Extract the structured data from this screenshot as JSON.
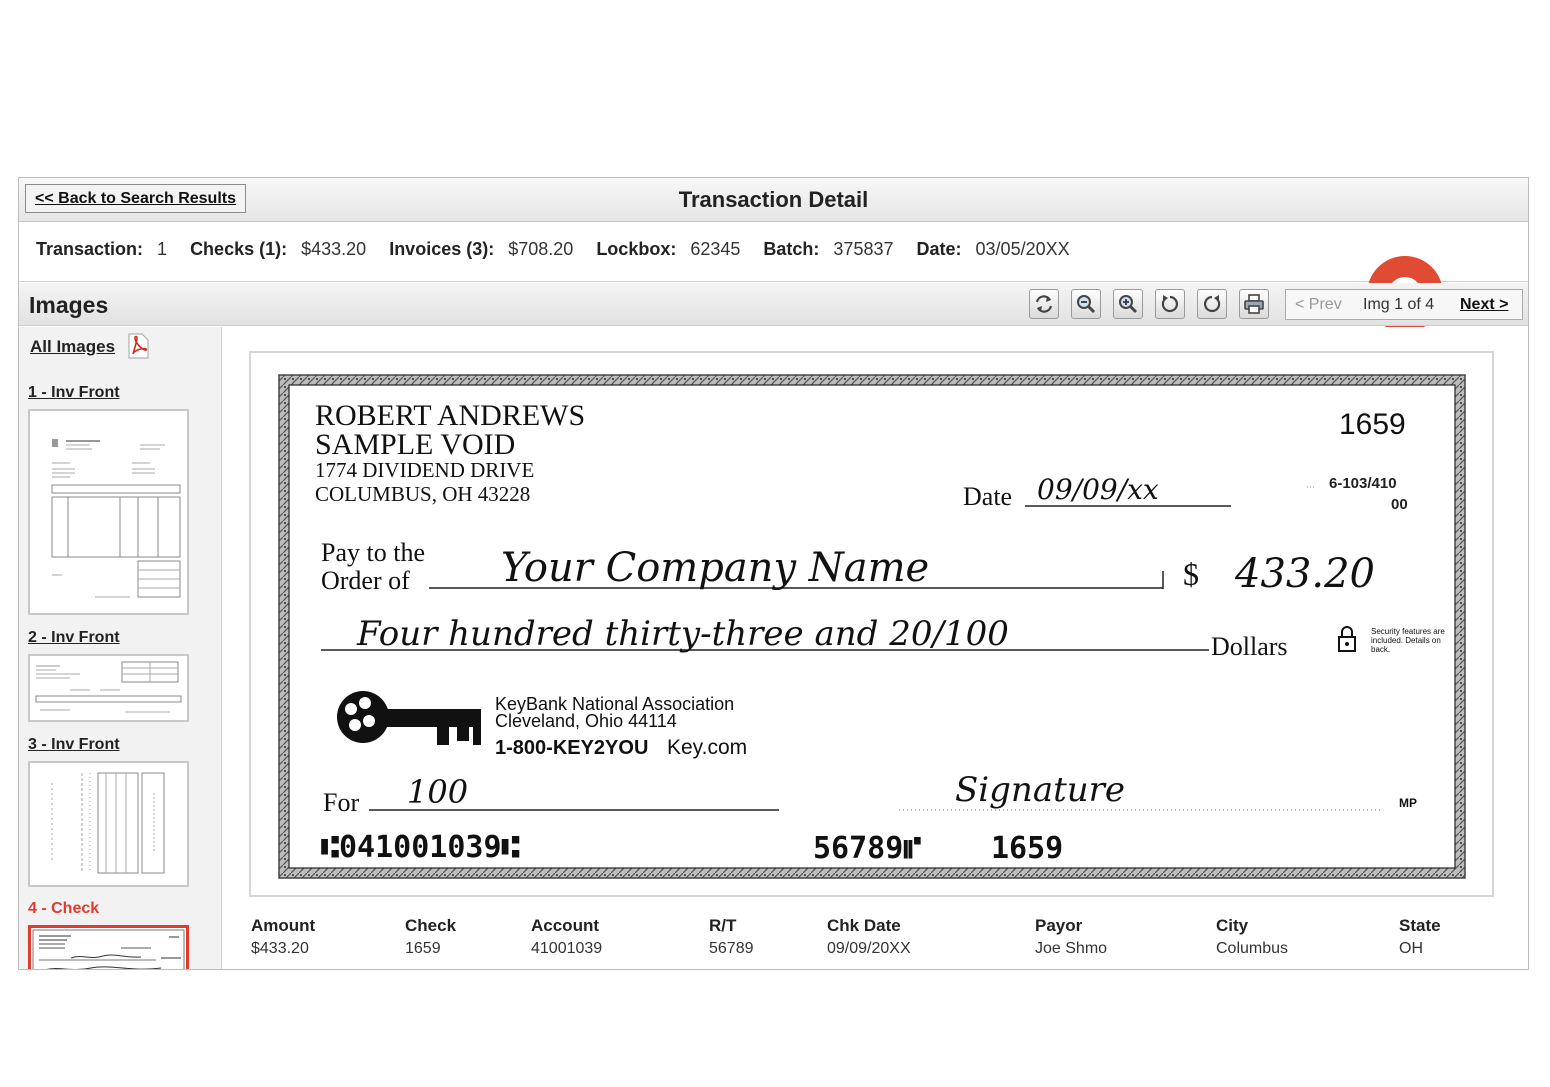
{
  "header": {
    "back_label": "<< Back to Search Results",
    "title": "Transaction Detail"
  },
  "summary": {
    "transaction_label": "Transaction:",
    "transaction_value": "1",
    "checks_label": "Checks (1):",
    "checks_value": "$433.20",
    "invoices_label": "Invoices (3):",
    "invoices_value": "$708.20",
    "lockbox_label": "Lockbox:",
    "lockbox_value": "62345",
    "batch_label": "Batch:",
    "batch_value": "375837",
    "date_label": "Date:",
    "date_value": "03/05/20XX"
  },
  "images": {
    "heading": "Images",
    "toolbar_icons": [
      "refresh-icon",
      "zoom-out-icon",
      "zoom-in-icon",
      "rotate-left-icon",
      "rotate-right-icon",
      "print-icon"
    ],
    "prev_label": "< Prev",
    "count_label": "Img 1 of 4",
    "next_label": "Next >"
  },
  "sidebar": {
    "all_images_label": "All Images",
    "thumbs": [
      {
        "label": "1 - Inv Front"
      },
      {
        "label": "2 - Inv Front"
      },
      {
        "label": "3 - Inv Front"
      },
      {
        "label": "4 - Check",
        "active": true
      }
    ]
  },
  "check": {
    "name_line1": "ROBERT ANDREWS",
    "name_line2": "SAMPLE VOID",
    "address1": "1774 DIVIDEND DRIVE",
    "address2": "COLUMBUS, OH  43228",
    "number": "1659",
    "routing_fraction": "6-103/410",
    "routing_sub": "00",
    "date_label": "Date",
    "date_value": "09/09/xx",
    "pay_label_1": "Pay to the",
    "pay_label_2": "Order of",
    "payee": "Your Company Name",
    "dollar_sign": "$",
    "amount": "433.20",
    "written_amount": "Four hundred thirty-three and 20/100",
    "dollars_label": "Dollars",
    "security_note": "Security features are included. Details on back.",
    "bank_name": "KeyBank National Association",
    "bank_city": "Cleveland, Ohio 44114",
    "bank_phone": "1-800-KEY2YOU",
    "bank_site": "Key.com",
    "for_label": "For",
    "memo": "100",
    "signature": "Signature",
    "mp_mark": "MP",
    "micr_routing": "⑆041001039⑆",
    "micr_account": "56789⑈",
    "micr_check": "1659"
  },
  "details": {
    "columns": [
      {
        "header": "Amount",
        "value": "$433.20"
      },
      {
        "header": "Check",
        "value": "1659"
      },
      {
        "header": "Account",
        "value": "41001039"
      },
      {
        "header": "R/T",
        "value": "56789"
      },
      {
        "header": "Chk Date",
        "value": "09/09/20XX"
      },
      {
        "header": "Payor",
        "value": "Joe Shmo"
      },
      {
        "header": "City",
        "value": "Columbus"
      },
      {
        "header": "State",
        "value": "OH"
      }
    ]
  },
  "colors": {
    "accent_red": "#e23a2e",
    "record_dot": "#e04b33"
  }
}
